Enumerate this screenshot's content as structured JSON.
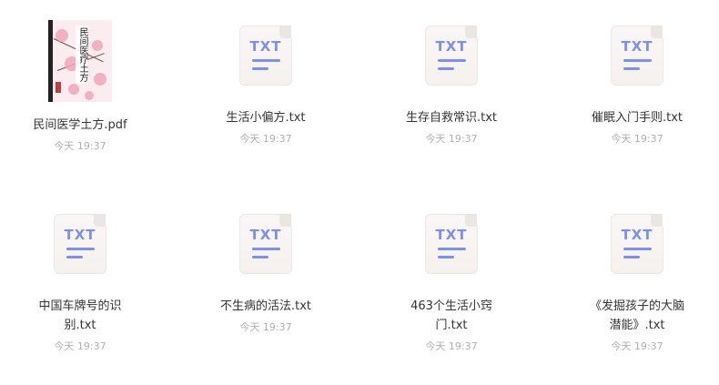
{
  "files": [
    {
      "name": "民间医学土方.pdf",
      "time": "今天 19:37",
      "type": "pdf",
      "cover_title": "民间医疗土方"
    },
    {
      "name": "生活小偏方.txt",
      "time": "今天 19:37",
      "type": "txt",
      "icon_label": "TXT"
    },
    {
      "name": "生存自救常识.txt",
      "time": "今天 19:37",
      "type": "txt",
      "icon_label": "TXT"
    },
    {
      "name": "催眠入门手则.txt",
      "time": "今天 19:37",
      "type": "txt",
      "icon_label": "TXT"
    },
    {
      "name": "中国车牌号的识别.txt",
      "time": "今天 19:37",
      "type": "txt",
      "icon_label": "TXT"
    },
    {
      "name": "不生病的活法.txt",
      "time": "今天 19:37",
      "type": "txt",
      "icon_label": "TXT"
    },
    {
      "name": "463个生活小窍门.txt",
      "time": "今天 19:37",
      "type": "txt",
      "icon_label": "TXT"
    },
    {
      "name": "《发掘孩子的大脑潜能》.txt",
      "time": "今天 19:37",
      "type": "txt",
      "icon_label": "TXT"
    }
  ],
  "icon_names": {
    "pdf": "book-cover-thumbnail",
    "txt": "txt-file-icon"
  },
  "colors": {
    "txt_accent": "#7c8ff0",
    "name_text": "#333333",
    "time_text": "#b0b0b0"
  }
}
